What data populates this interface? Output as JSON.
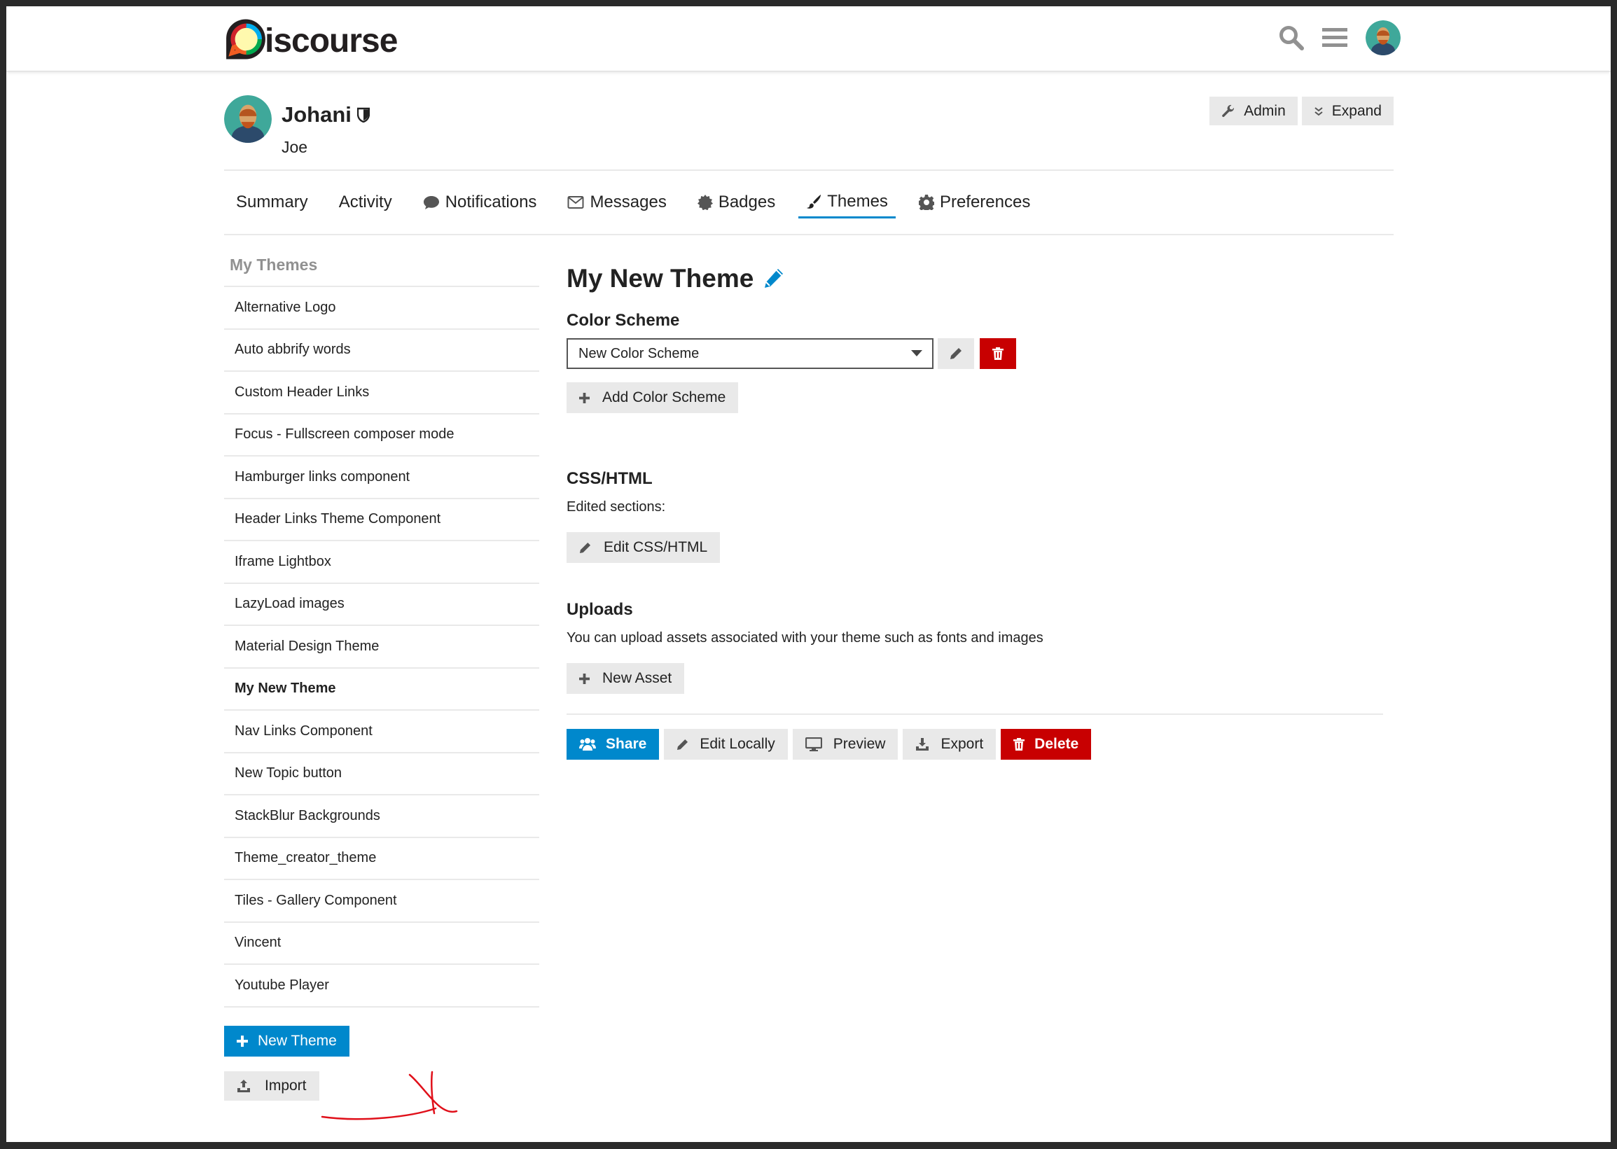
{
  "header": {
    "logo_text": "iscourse",
    "logo_icon": "discourse-logo-icon"
  },
  "user": {
    "username": "Johani",
    "name": "Joe",
    "admin_label": "Admin",
    "expand_label": "Expand"
  },
  "nav": {
    "tabs": [
      {
        "label": "Summary",
        "icon": ""
      },
      {
        "label": "Activity",
        "icon": ""
      },
      {
        "label": "Notifications",
        "icon": "comment-icon"
      },
      {
        "label": "Messages",
        "icon": "envelope-icon"
      },
      {
        "label": "Badges",
        "icon": "certificate-icon"
      },
      {
        "label": "Themes",
        "icon": "paintbrush-icon",
        "active": true
      },
      {
        "label": "Preferences",
        "icon": "gear-icon"
      }
    ]
  },
  "sidebar": {
    "title": "My Themes",
    "items": [
      "Alternative Logo",
      "Auto abbrify words",
      "Custom Header Links",
      "Focus - Fullscreen composer mode",
      "Hamburger links component",
      "Header Links Theme Component",
      "Iframe Lightbox",
      "LazyLoad images",
      "Material Design Theme",
      "My New Theme",
      "Nav Links Component",
      "New Topic button",
      "StackBlur Backgrounds",
      "Theme_creator_theme",
      "Tiles - Gallery Component",
      "Vincent",
      "Youtube Player"
    ],
    "new_theme_label": "New Theme",
    "import_label": "Import"
  },
  "main": {
    "theme_title": "My New Theme",
    "color_scheme": {
      "heading": "Color Scheme",
      "selected": "New Color Scheme",
      "add_label": "Add Color Scheme"
    },
    "css_html": {
      "heading": "CSS/HTML",
      "edited_sections": "Edited sections:",
      "edit_label": "Edit CSS/HTML"
    },
    "uploads": {
      "heading": "Uploads",
      "description": "You can upload assets associated with your theme such as fonts and images",
      "new_asset_label": "New Asset"
    },
    "actions": {
      "share": "Share",
      "edit_locally": "Edit Locally",
      "preview": "Preview",
      "export": "Export",
      "delete": "Delete"
    }
  },
  "colors": {
    "accent_blue": "#0088cc",
    "danger_red": "#c80001",
    "button_gray": "#e9e9e9",
    "annotation_red": "#e0101a"
  }
}
